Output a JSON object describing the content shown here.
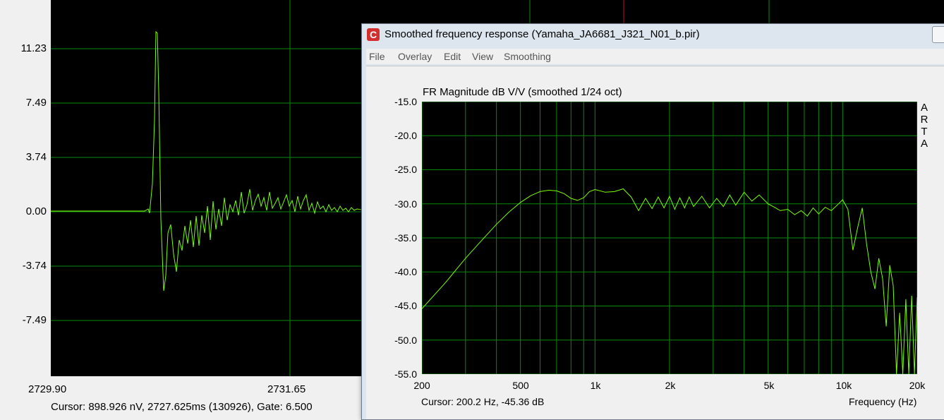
{
  "background_window": {
    "y_ticks": [
      "11.23",
      "7.49",
      "3.74",
      "0.00",
      "-3.74",
      "-7.49"
    ],
    "x_ticks": [
      "2729.90",
      "2731.65"
    ],
    "cursor_text": "Cursor: 898.926 nV, 2727.625ms (130926), Gate: 6.500"
  },
  "window": {
    "title": "Smoothed frequency response (Yamaha_JA6681_J321_N01_b.pir)",
    "app_icon": "arta-c-icon",
    "close_label": "✕"
  },
  "menu": {
    "items": [
      "File",
      "Overlay",
      "Edit",
      "View",
      "Smoothing"
    ]
  },
  "plot": {
    "watermark": [
      "A",
      "R",
      "T",
      "A"
    ],
    "cursor_text": "Cursor: 200.2 Hz, -45.36 dB",
    "line_color": "#7CFC00",
    "grid_color": "#0a8a0a"
  },
  "chart_data": [
    {
      "type": "line",
      "title": "FR Magnitude dB V/V (smoothed 1/24 oct)",
      "xlabel": "Frequency (Hz)",
      "ylabel": "",
      "xscale": "log",
      "xlim": [
        200,
        20000
      ],
      "ylim": [
        -55,
        -15
      ],
      "x_tick_labels": [
        "200",
        "500",
        "1k",
        "2k",
        "5k",
        "10k",
        "20k"
      ],
      "x_ticks": [
        200,
        500,
        1000,
        2000,
        5000,
        10000,
        20000
      ],
      "y_tick_labels": [
        "-15.0",
        "-20.0",
        "-25.0",
        "-30.0",
        "-35.0",
        "-40.0",
        "-45.0",
        "-50.0",
        "-55.0"
      ],
      "y_ticks": [
        -15,
        -20,
        -25,
        -30,
        -35,
        -40,
        -45,
        -50,
        -55
      ],
      "grid": true,
      "series": [
        {
          "x": [
            200,
            250,
            300,
            350,
            400,
            450,
            500,
            550,
            600,
            650,
            700,
            750,
            800,
            850,
            900,
            950,
            1000,
            1100,
            1200,
            1300,
            1400,
            1500,
            1600,
            1700,
            1800,
            1900,
            2000,
            2100,
            2200,
            2300,
            2400,
            2500,
            2700,
            2900,
            3100,
            3300,
            3500,
            3700,
            4000,
            4300,
            4600,
            5000,
            5300,
            5600,
            6000,
            6400,
            6800,
            7200,
            7600,
            8000,
            8500,
            9000,
            9500,
            10000,
            10500,
            11000,
            11500,
            12000,
            12500,
            13000,
            13500,
            14000,
            14500,
            15000,
            15500,
            16000,
            16500,
            17000,
            17500,
            18000,
            18500,
            19000,
            19500,
            20000
          ],
          "y": [
            -45.4,
            -41.5,
            -38.0,
            -35.3,
            -33.0,
            -31.2,
            -29.8,
            -28.8,
            -28.2,
            -28.0,
            -28.1,
            -28.5,
            -29.2,
            -29.5,
            -29.1,
            -28.2,
            -27.9,
            -28.3,
            -28.2,
            -27.8,
            -29.0,
            -31.0,
            -29.2,
            -30.7,
            -29.0,
            -30.6,
            -28.9,
            -30.8,
            -29.1,
            -30.6,
            -29.0,
            -30.4,
            -28.9,
            -30.6,
            -29.2,
            -30.4,
            -28.7,
            -30.2,
            -28.3,
            -29.6,
            -28.7,
            -30.0,
            -30.5,
            -31.0,
            -30.8,
            -31.6,
            -31.0,
            -31.8,
            -30.6,
            -31.5,
            -30.5,
            -31.0,
            -30.2,
            -29.4,
            -30.8,
            -36.8,
            -33.5,
            -30.6,
            -36.0,
            -40.0,
            -42.5,
            -38.0,
            -41.0,
            -48.0,
            -39.0,
            -42.0,
            -55.0,
            -46.0,
            -55.0,
            -44.0,
            -55.0,
            -43.5,
            -55.0,
            -43.7
          ]
        }
      ]
    }
  ]
}
